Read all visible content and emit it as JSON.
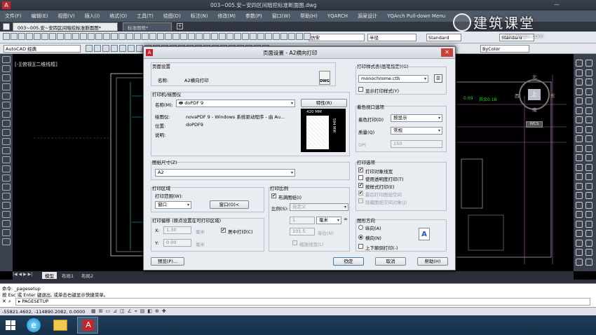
{
  "window_title": "003~005.安~安四区间暗挖标准断面图.dwg",
  "menu": [
    "文件(F)",
    "编辑(E)",
    "视图(V)",
    "插入(I)",
    "格式(O)",
    "工具(T)",
    "绘图(D)",
    "标注(N)",
    "修改(M)",
    "参数(P)",
    "窗口(W)",
    "帮助(H)",
    "YQARCH",
    "源泉设计",
    "YQArch Pull-down Menu"
  ],
  "doc_tabs": [
    "003~005.安~安四区间暗挖标准断面图*",
    "标准图框*"
  ],
  "toolbar": {
    "linetype": "仿宋",
    "lineweight": "半径",
    "textstyle": "Standard",
    "dimstyle": "Standard"
  },
  "toolbar2": {
    "workspace": "AutoCAD 经典",
    "bycolor": "ByColor"
  },
  "viewport_label": "[-][俯视][二维线框]",
  "watermark": {
    "brand": "建筑课堂",
    "url": "jzkt.wxgx.com"
  },
  "viewcube": {
    "north": "北",
    "south": "南",
    "east": "东",
    "west": "西",
    "top": "上",
    "wcs": "WCS"
  },
  "drawing_labels": {
    "annot1": "0.09",
    "annot2": "其余0.18"
  },
  "layout_tabs": [
    "模型",
    "布局1",
    "布局2"
  ],
  "command": {
    "line1": "命令: _pagesetup",
    "line2": "按 Esc 或 Enter 键退出, 或单击右键显示快捷菜单。",
    "prompt": "PAGESETUP"
  },
  "status": {
    "coords": "-55821.4602, -114890.2082, 0.0000"
  },
  "dialog": {
    "title": "页面设置 - A2横向打印",
    "page_setup": {
      "group": "页面设置",
      "name_label": "名称:",
      "name_value": "A2横向打印"
    },
    "printer": {
      "group": "打印机/绘图仪",
      "name_label": "名称(M):",
      "name_value": "doPDF 9",
      "props_button": "特性(R)",
      "plotter_label": "绘图仪:",
      "plotter_value": "novaPDF 9 - Windows 系统驱动程序 - 由 Au...",
      "where_label": "位置:",
      "where_value": "doPDF9",
      "desc_label": "说明:",
      "preview_width": "420 MM",
      "preview_height": "594 MM"
    },
    "paper": {
      "group": "图纸尺寸(Z)",
      "value": "A2"
    },
    "plot_area": {
      "group": "打印区域",
      "range_label": "打印范围(W):",
      "range_value": "窗口",
      "window_button": "窗口(O)<"
    },
    "plot_offset": {
      "group": "打印偏移 (原点设置在可打印区域)",
      "x_label": "X:",
      "x_value": "1.30",
      "x_unit": "毫米",
      "y_label": "Y:",
      "y_value": "0.00",
      "y_unit": "毫米",
      "center_label": "居中打印(C)"
    },
    "plot_scale": {
      "group": "打印比例",
      "fit_label": "布满图纸(I)",
      "scale_label": "比例(S):",
      "scale_value": "自定义",
      "val1": "1",
      "unit": "毫米",
      "val2": "101.5",
      "unit2_label": "单位(N)",
      "lineweight_label": "缩放线宽(L)"
    },
    "plot_style": {
      "group": "打印样式表(画笔指定)(G)",
      "value": "monochrome.ctb",
      "show_label": "显示打印样式(Y)"
    },
    "shaded": {
      "group": "着色视口选项",
      "shade_label": "着色打印(D)",
      "shade_value": "按显示",
      "quality_label": "质量(Q)",
      "quality_value": "常规",
      "dpi_label": "DPI",
      "dpi_value": "150"
    },
    "options": {
      "group": "打印选项",
      "items": [
        "打印对象线宽",
        "使用透明度打印(T)",
        "按样式打印(E)",
        "最后打印图纸空间",
        "隐藏图纸空间对象(J)"
      ],
      "checked": [
        true,
        false,
        true,
        true,
        false
      ],
      "disabled": [
        false,
        false,
        false,
        true,
        true
      ]
    },
    "orientation": {
      "group": "图形方向",
      "portrait": "纵向(A)",
      "landscape": "横向(N)",
      "upside": "上下颠倒打印(-)"
    },
    "buttons": {
      "preview": "预览(P)...",
      "ok": "确定",
      "cancel": "取消",
      "help": "帮助(H)"
    }
  },
  "taskbar_apps": [
    "windows-start",
    "ie-browser",
    "file-explorer",
    "autocad"
  ]
}
